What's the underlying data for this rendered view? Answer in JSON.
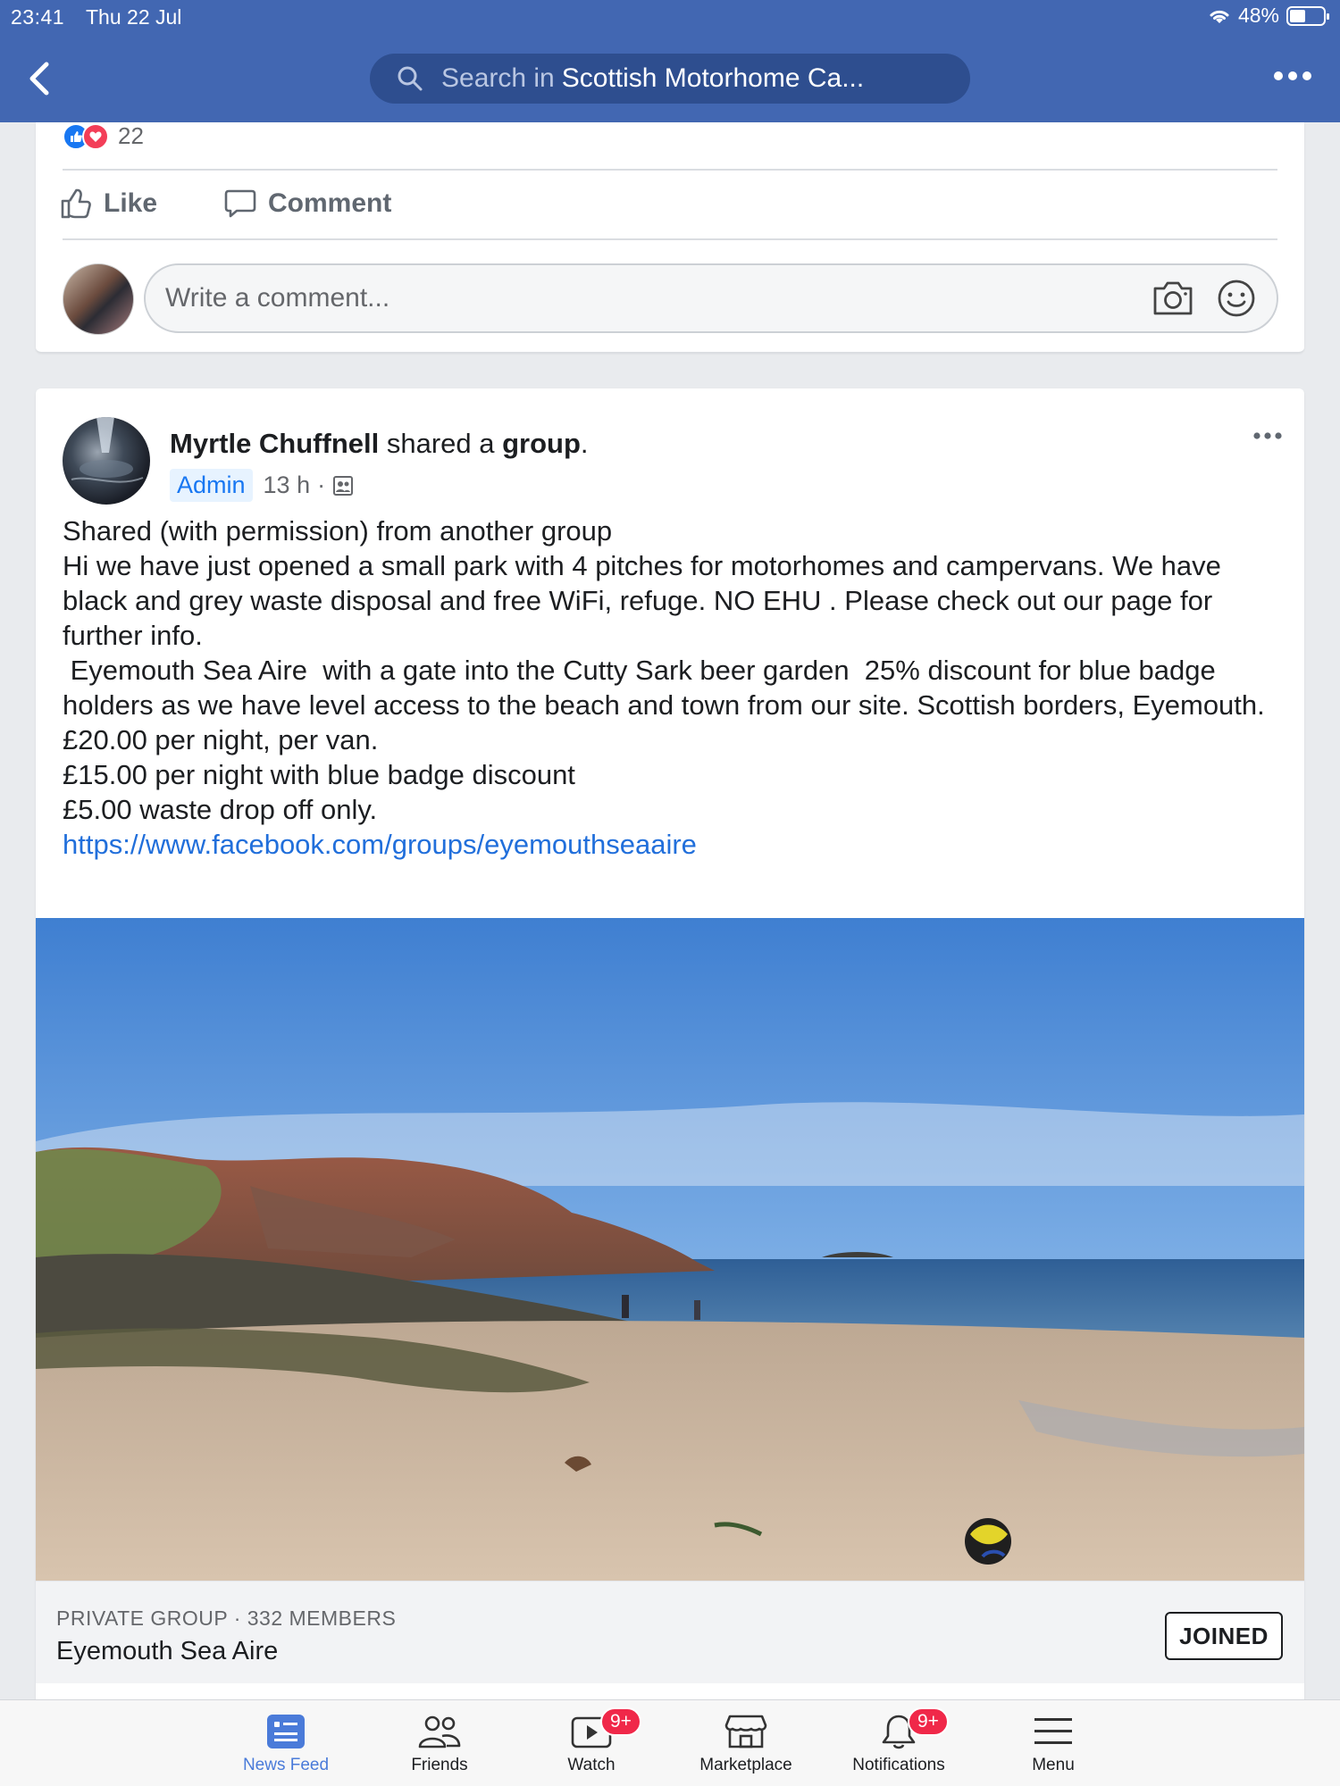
{
  "status_bar": {
    "time": "23:41",
    "date": "Thu 22 Jul",
    "battery": "48%"
  },
  "search": {
    "prefix": "Search in",
    "group_name": "Scottish Motorhome Ca..."
  },
  "previous_post": {
    "reaction_count": "22",
    "like_label": "Like",
    "comment_label": "Comment",
    "comment_placeholder": "Write a comment..."
  },
  "post": {
    "author": "Myrtle Chuffnell",
    "action_text": " shared a ",
    "object": "group",
    "period": ".",
    "badge": "Admin",
    "time": "13 h",
    "separator": "·",
    "body": "Shared (with permission) from another group\nHi we have just opened a small park with 4 pitches for motorhomes and campervans. We have black and grey waste disposal and free WiFi, refuge. NO EHU . Please check out our page for further info.\n Eyemouth Sea Aire  with a gate into the Cutty Sark beer garden  25% discount for blue badge holders as we have level access to the beach and town from our site. Scottish borders, Eyemouth.\n£20.00 per night, per van.\n£15.00 per night with blue badge discount\n£5.00 waste drop off only.",
    "link": "https://www.facebook.com/groups/eyemouthseaaire"
  },
  "shared_group": {
    "meta": "PRIVATE GROUP · 332 MEMBERS",
    "name": "Eyemouth Sea Aire",
    "button": "JOINED"
  },
  "tabs": [
    {
      "label": "News Feed",
      "icon": "news-feed-icon",
      "active": true
    },
    {
      "label": "Friends",
      "icon": "friends-icon"
    },
    {
      "label": "Watch",
      "icon": "watch-icon",
      "badge": "9+"
    },
    {
      "label": "Marketplace",
      "icon": "marketplace-icon"
    },
    {
      "label": "Notifications",
      "icon": "bell-icon",
      "badge": "9+"
    },
    {
      "label": "Menu",
      "icon": "menu-icon"
    }
  ],
  "colors": {
    "brand": "#4267b2",
    "link": "#216fdb",
    "badge": "#f02849",
    "active_tab": "#4a7bd9"
  }
}
